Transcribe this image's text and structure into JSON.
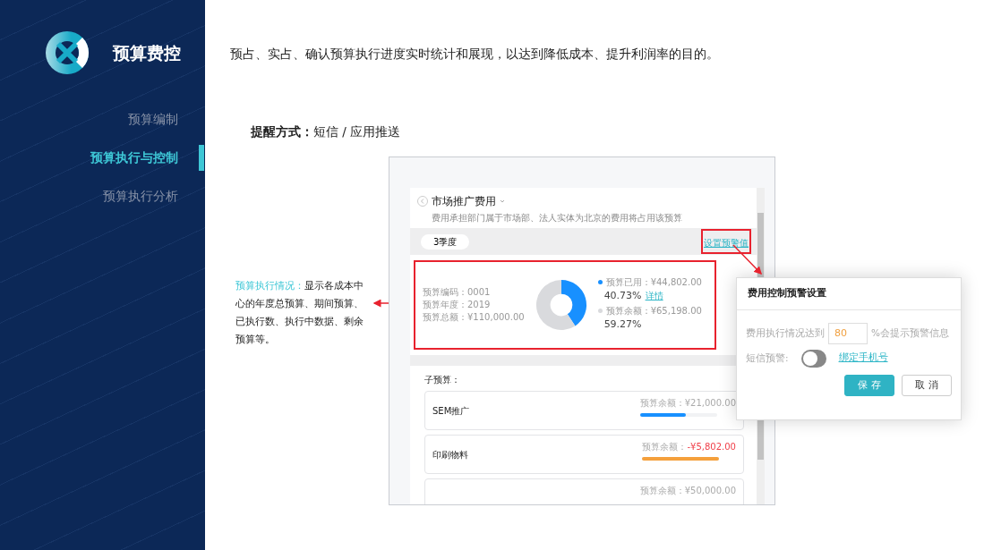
{
  "sidebar": {
    "title": "预算费控",
    "items": [
      {
        "label": "预算编制",
        "selected": false
      },
      {
        "label": "预算执行与控制",
        "selected": true
      },
      {
        "label": "预算执行分析",
        "selected": false
      }
    ]
  },
  "intro": "预占、实占、确认预算执行进度实时统计和展现，以达到降低成本、提升利润率的目的。",
  "reminder": "**提醒方式：**短信 / 应用推送",
  "annotation": {
    "label": "预算执行情况：",
    "text": "显示各成本中心的年度总预算、期间预算、已执行数、执行中数据、剩余预算等。"
  },
  "mockup": {
    "title": "市场推广费用",
    "subtitle": "费用承担部门属于市场部、法人实体为北京的费用将占用该预算",
    "period": "3季度",
    "warning_link": "设置预警值",
    "info": [
      "预算编码：0001",
      "预算年度：2019",
      "预算总额：¥110,000.00"
    ],
    "legend": [
      {
        "amount": "：¥44,802.00",
        "percent": "40.73%",
        "color": "#1890ff",
        "link": "详情"
      },
      {
        "amount": "：¥65,198.00",
        "percent": "59.27%",
        "color": "#d9dadd"
      }
    ],
    "chart_data": {
      "type": "donut",
      "categories": [
        "预算已用",
        "预算余额"
      ],
      "values": [
        40.73,
        59.27
      ]
    },
    "sub_label": "子预算：",
    "sub_budgets": [
      {
        "name": "SEM推广",
        "amount_label": "预算余额：",
        "amount_value": "¥21,000.00",
        "level": 0.6,
        "over": false
      },
      {
        "name": "印刷物料",
        "amount_label": "预算余额：",
        "amount_value": "-¥5,802.00",
        "level": 1,
        "over": true
      },
      {
        "amount_label": "预算余额：",
        "amount_value": "¥50,000.00"
      }
    ]
  },
  "dialog": {
    "title": "费用控制预警设置",
    "threshold_prefix": "费用执行情况达到",
    "threshold_value": "80",
    "threshold_suffix": "%会提示预警信息",
    "sms_label": "短信预警:",
    "sms_on": false,
    "bind_link": "绑定手机号",
    "buttons": [
      {
        "label": "保存",
        "kind": "primary"
      },
      {
        "label": "取消",
        "kind": "secondary"
      }
    ]
  }
}
